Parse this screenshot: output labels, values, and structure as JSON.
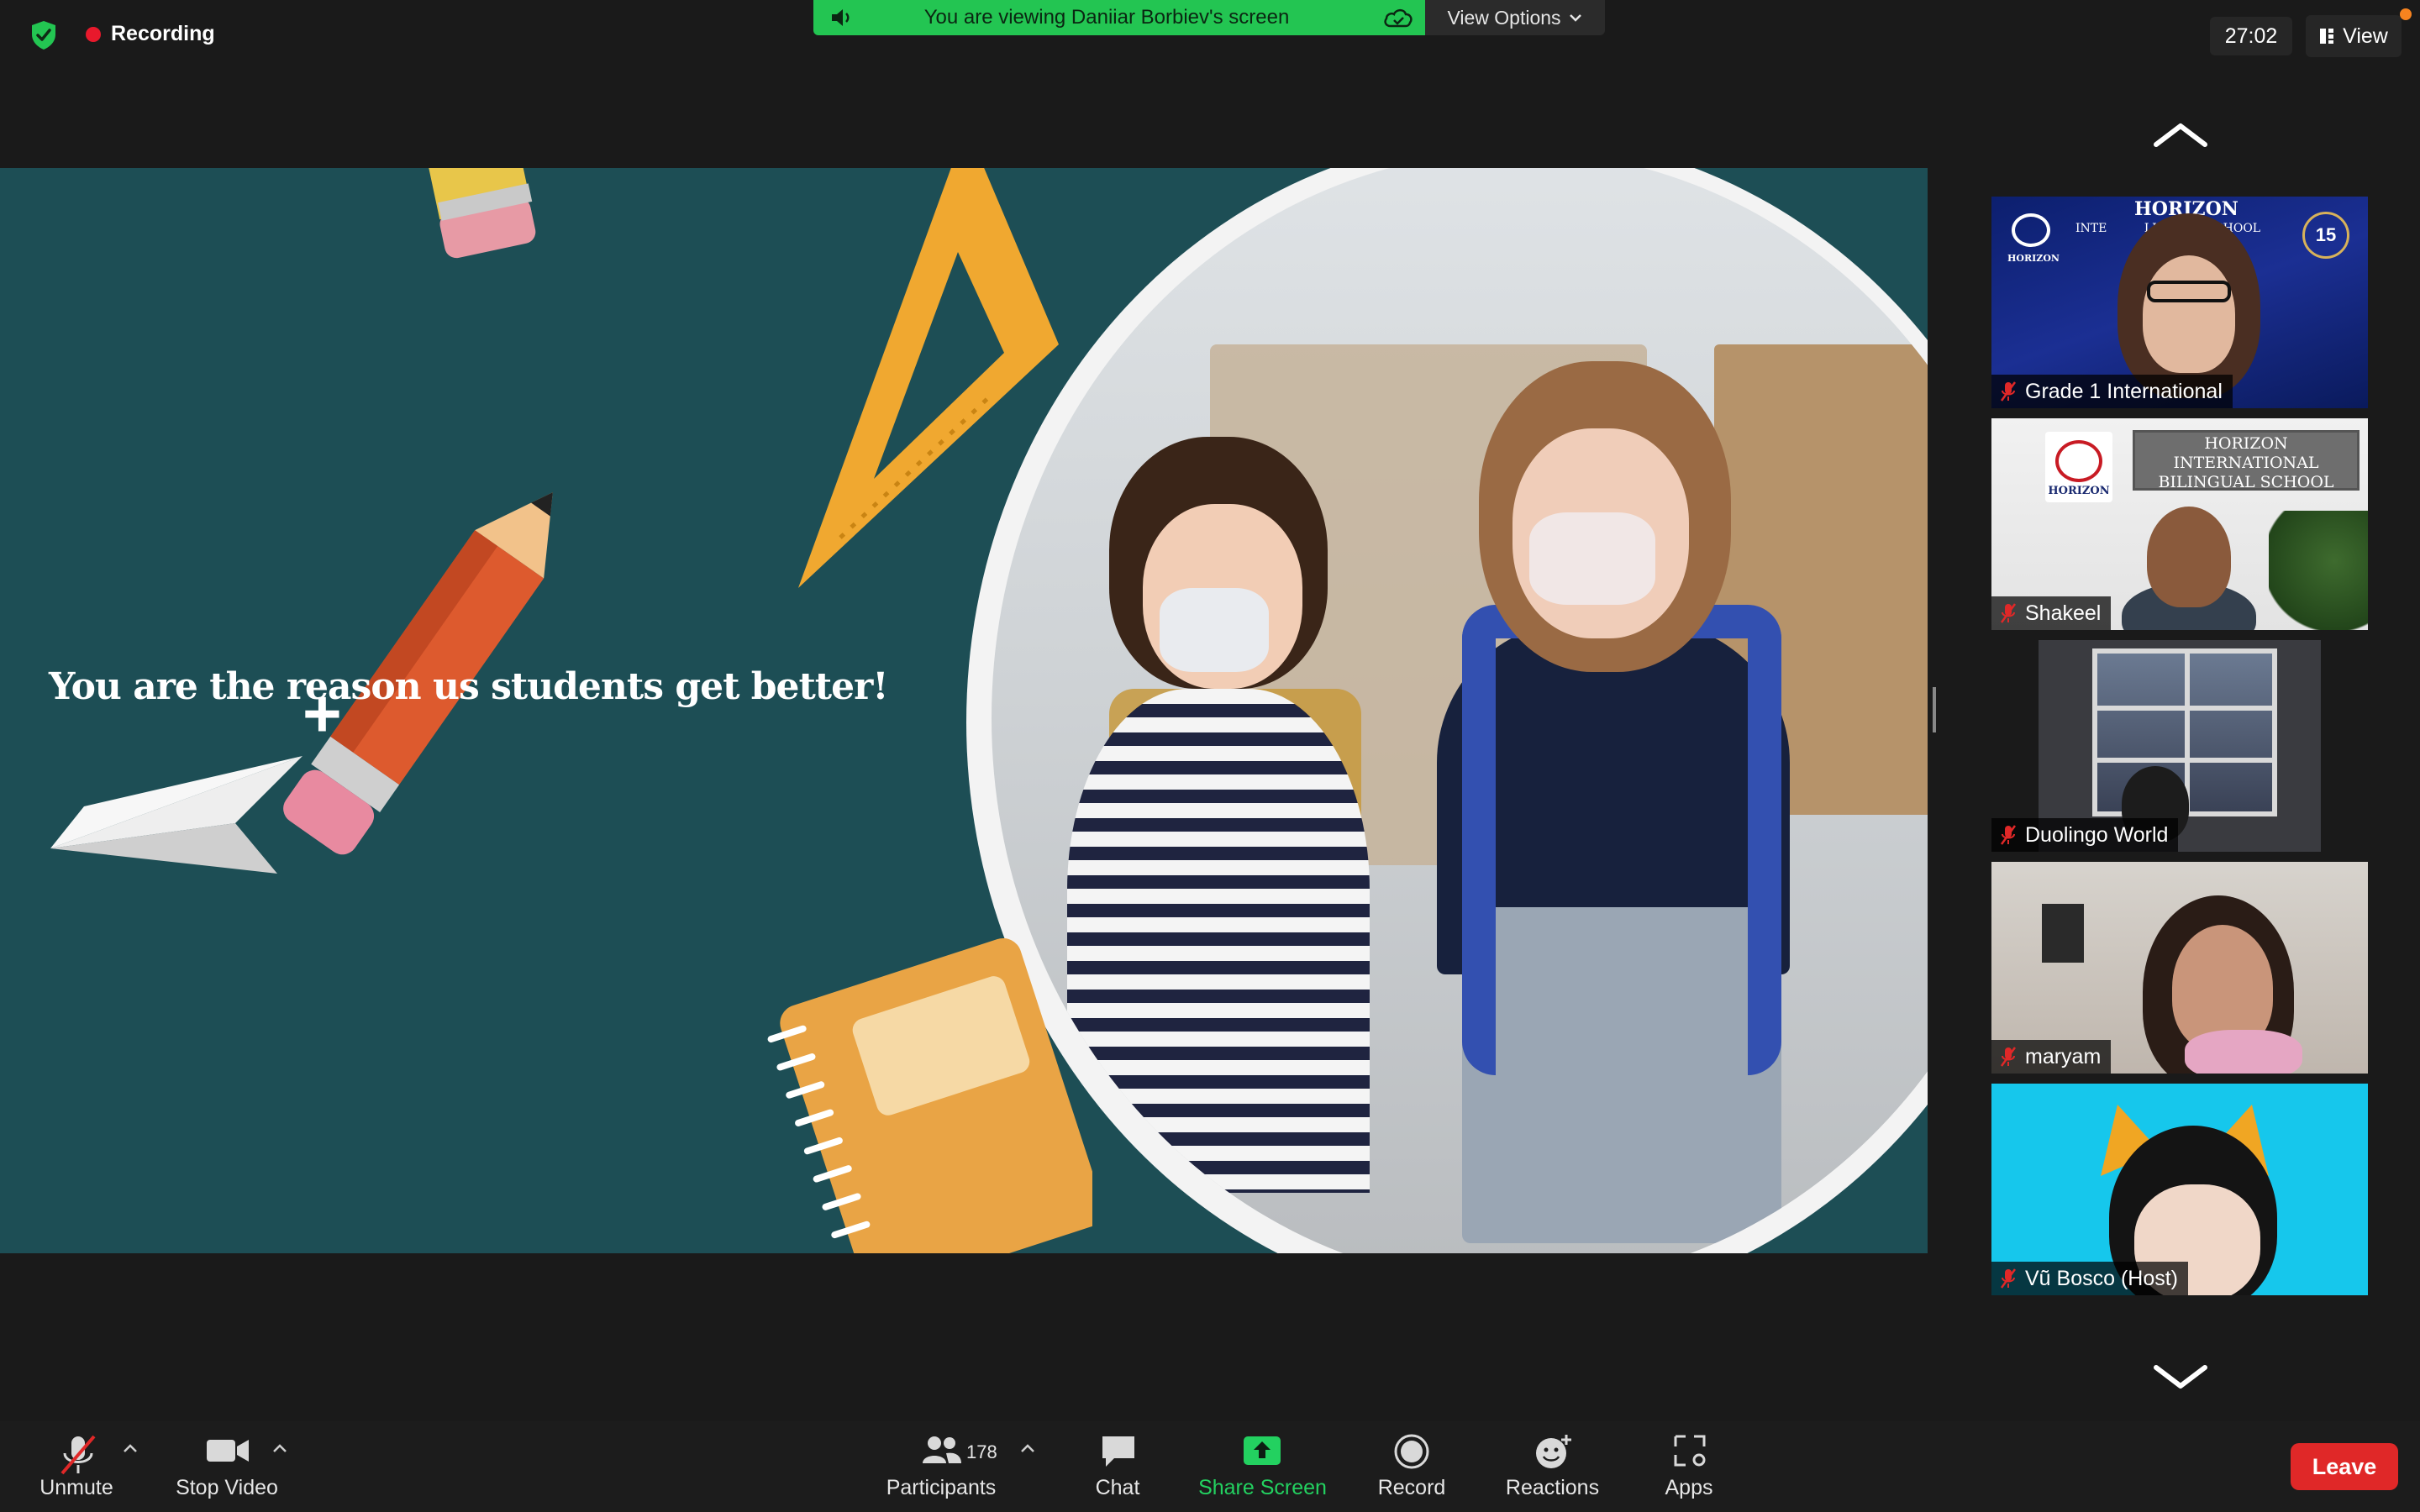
{
  "topbar": {
    "recording_label": "Recording",
    "share_banner_text": "You are viewing Daniiar Borbiev's screen",
    "view_options_label": "View Options",
    "timer": "27:02",
    "view_label": "View"
  },
  "shared_screen": {
    "slide_text": "You are the reason us students get better!",
    "plus_glyph": "+"
  },
  "participants": [
    {
      "name": "Grade 1 International",
      "muted": true
    },
    {
      "name": "Shakeel",
      "muted": true
    },
    {
      "name": "Duolingo World",
      "muted": true
    },
    {
      "name": "maryam",
      "muted": true
    },
    {
      "name": "Vũ Bosco (Host)",
      "muted": true
    }
  ],
  "tile_text": {
    "t1_school": "HORIZON",
    "t1_school_line2": "INTE          LINGUAL SCHOOL",
    "t1_badge": "15",
    "t2_box": "HORIZON INTERNATIONAL BILINGUAL SCHOOL",
    "t2_box_line1": "HORIZON",
    "t2_box_line2": "INTERNATIONAL",
    "t2_box_line3": "BILINGUAL SCHOOL",
    "logo_caption": "HORIZON"
  },
  "toolbar": {
    "unmute": "Unmute",
    "stop_video": "Stop Video",
    "participants": "Participants",
    "participants_count": "178",
    "chat": "Chat",
    "share_screen": "Share Screen",
    "record": "Record",
    "reactions": "Reactions",
    "apps": "Apps",
    "leave": "Leave"
  },
  "colors": {
    "banner_green": "#23c552",
    "recording_red": "#e8192c",
    "leave_red": "#e02828",
    "share_screen_green": "#23d160",
    "slide_bg": "#1d4e55"
  },
  "icons": [
    "shield-check-icon",
    "speaker-icon",
    "cloud-icon",
    "chevron-down-icon",
    "grid-view-icon",
    "chevron-up-icon",
    "mic-muted-icon",
    "video-camera-icon",
    "participants-icon",
    "chat-bubble-icon",
    "share-screen-arrow-icon",
    "record-circle-icon",
    "reactions-smiley-icon",
    "apps-icon"
  ]
}
